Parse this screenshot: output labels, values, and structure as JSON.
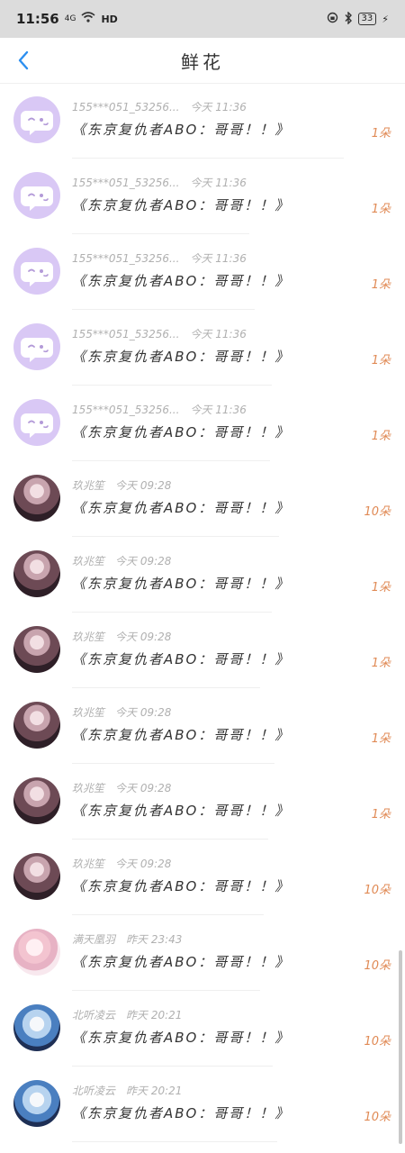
{
  "status_bar": {
    "time": "11:56",
    "signal": "4G",
    "wifi": "HD",
    "battery": "33"
  },
  "nav": {
    "title": "鲜花"
  },
  "items": [
    {
      "sender": "155***051_53256...",
      "time": "今天 11:36",
      "title": "《东京复仇者ABO：哥哥！！》",
      "count": "1朵",
      "avatar": "chat-bubble"
    },
    {
      "sender": "155***051_53256...",
      "time": "今天 11:36",
      "title": "《东京复仇者ABO：哥哥！！》",
      "count": "1朵",
      "avatar": "chat-bubble"
    },
    {
      "sender": "155***051_53256...",
      "time": "今天 11:36",
      "title": "《东京复仇者ABO：哥哥！！》",
      "count": "1朵",
      "avatar": "chat-bubble"
    },
    {
      "sender": "155***051_53256...",
      "time": "今天 11:36",
      "title": "《东京复仇者ABO：哥哥！！》",
      "count": "1朵",
      "avatar": "chat-bubble"
    },
    {
      "sender": "155***051_53256...",
      "time": "今天 11:36",
      "title": "《东京复仇者ABO：哥哥！！》",
      "count": "1朵",
      "avatar": "chat-bubble"
    },
    {
      "sender": "玖兆笙",
      "time": "今天 09:28",
      "title": "《东京复仇者ABO：哥哥！！》",
      "count": "10朵",
      "avatar": "anime-girl-dark"
    },
    {
      "sender": "玖兆笙",
      "time": "今天 09:28",
      "title": "《东京复仇者ABO：哥哥！！》",
      "count": "1朵",
      "avatar": "anime-girl-dark"
    },
    {
      "sender": "玖兆笙",
      "time": "今天 09:28",
      "title": "《东京复仇者ABO：哥哥！！》",
      "count": "1朵",
      "avatar": "anime-girl-dark"
    },
    {
      "sender": "玖兆笙",
      "time": "今天 09:28",
      "title": "《东京复仇者ABO：哥哥！！》",
      "count": "1朵",
      "avatar": "anime-girl-dark"
    },
    {
      "sender": "玖兆笙",
      "time": "今天 09:28",
      "title": "《东京复仇者ABO：哥哥！！》",
      "count": "1朵",
      "avatar": "anime-girl-dark"
    },
    {
      "sender": "玖兆笙",
      "time": "今天 09:28",
      "title": "《东京复仇者ABO：哥哥！！》",
      "count": "10朵",
      "avatar": "anime-girl-dark"
    },
    {
      "sender": "满天凰羽",
      "time": "昨天 23:43",
      "title": "《东京复仇者ABO：哥哥！！》",
      "count": "10朵",
      "avatar": "anime-girl-pink"
    },
    {
      "sender": "北听凌云",
      "time": "昨天 20:21",
      "title": "《东京复仇者ABO：哥哥！！》",
      "count": "10朵",
      "avatar": "anime-girl-blue"
    },
    {
      "sender": "北听凌云",
      "time": "昨天 20:21",
      "title": "《东京复仇者ABO：哥哥！！》",
      "count": "10朵",
      "avatar": "anime-girl-blue"
    }
  ],
  "colors": {
    "accent_back": "#2c8ff0",
    "count_orange": "#e08a55",
    "chat_avatar_bg": "#d9c8f5"
  }
}
